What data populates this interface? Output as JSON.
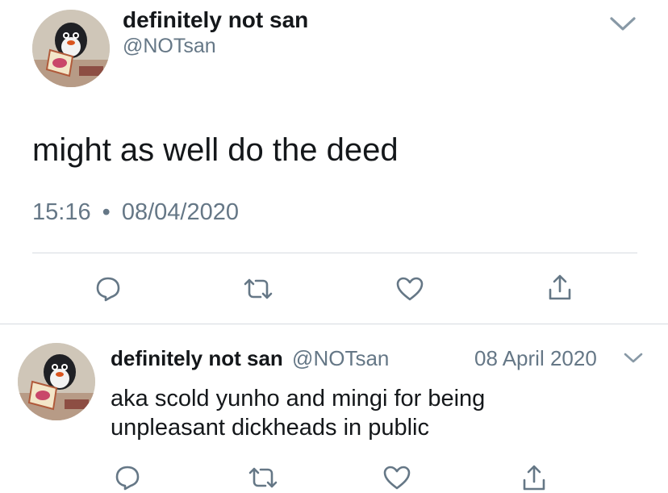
{
  "main_tweet": {
    "display_name": "definitely not san",
    "handle": "@NOTsan",
    "text": "might as well do the deed",
    "time": "15:16",
    "separator": "•",
    "date": "08/04/2020"
  },
  "reply_tweet": {
    "display_name": "definitely not san",
    "handle": "@NOTsan",
    "date": "08 April 2020",
    "text_line1": "aka scold yunho and mingi for being",
    "text_line2": "unpleasant dickheads in public"
  },
  "icons": {
    "menu": "chevron-down-icon",
    "reply": "reply-icon",
    "retweet": "retweet-icon",
    "like": "heart-icon",
    "share": "share-icon"
  },
  "colors": {
    "text": "#14171a",
    "muted": "#657786",
    "icon": "#657786",
    "divider": "#d6dbe0"
  }
}
